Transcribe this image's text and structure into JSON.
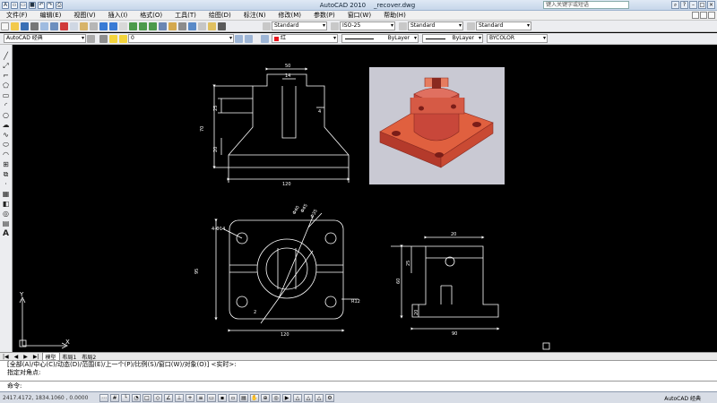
{
  "app": {
    "title": "AutoCAD 2010",
    "filename": "_recover.dwg",
    "search_placeholder": "键入关键字或短语"
  },
  "menu": [
    "文件(F)",
    "编辑(E)",
    "视图(V)",
    "插入(I)",
    "格式(O)",
    "工具(T)",
    "绘图(D)",
    "标注(N)",
    "修改(M)",
    "参数(P)",
    "窗口(W)",
    "帮助(H)"
  ],
  "toolbar": {
    "text_style": "Standard",
    "dim_style": "ISO-25",
    "table_style": "Standard",
    "ml_style": "Standard",
    "workspace": "AutoCAD 经典",
    "layer": "0",
    "color": "红",
    "linetype": "ByLayer",
    "lineweight": "ByLayer",
    "plotstyle": "BYCOLOR"
  },
  "colors": {
    "color_swatch": "#e8171f",
    "preview_bg": "#c9c9d3",
    "part_face": "#e0603f",
    "part_shade": "#a32d25"
  },
  "drawing": {
    "front": {
      "d_top": "50",
      "d_slot": "14",
      "d_bottom": "120",
      "d_h1": "70",
      "d_h2": "25",
      "d_h3": "20",
      "d_right": "4"
    },
    "top": {
      "d_phi1": "Φ40",
      "d_phi2": "Φ45",
      "d_phi3": "Φ35",
      "d_hole": "4-Φ14",
      "d_r": "2",
      "d_h": "95",
      "d_w": "120",
      "d_small": "R12"
    },
    "side": {
      "d_top": "20",
      "d_h1": "25",
      "d_h2": "60",
      "d_h3": "20",
      "d_w": "90"
    },
    "ucs_x": "X",
    "ucs_y": "Y"
  },
  "tabs": [
    "模型",
    "布局1",
    "布局2"
  ],
  "command": {
    "line1": "[全部(A)/中心(C)/动态(D)/范围(E)/上一个(P)/比例(S)/窗口(W)/对象(O)] <实时>:",
    "line2": "指定对角点:",
    "prompt": "命令:"
  },
  "status": {
    "coords": "2417.4172, 1834.1060 , 0.0000",
    "workspace_label": "AutoCAD 经典"
  }
}
